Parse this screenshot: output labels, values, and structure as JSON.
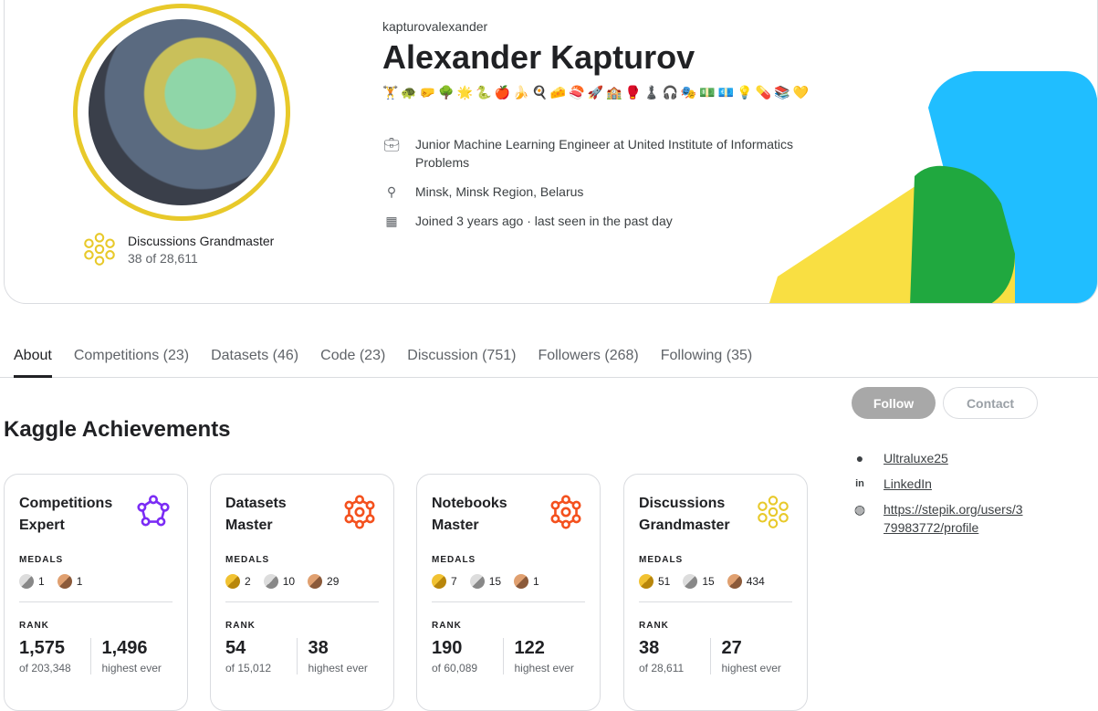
{
  "profile": {
    "username": "kapturovalexander",
    "name": "Alexander Kapturov",
    "emojis": "🏋️🐢🤛🌳🌟🐍🍎🍌🍳🧀🍣🚀🏫🥊♟️🎧🎭💵💶💡💊📚💛",
    "job": "Junior Machine Learning Engineer at United Institute of Informatics Problems",
    "location": "Minsk, Minsk Region, Belarus",
    "joined": "Joined 3 years ago · last seen in the past day",
    "tier": "Discussions Grandmaster",
    "tier_rank": "38 of 28,611"
  },
  "tabs": [
    "About",
    "Competitions (23)",
    "Datasets (46)",
    "Code (23)",
    "Discussion (751)",
    "Followers (268)",
    "Following (35)"
  ],
  "section_title": "Kaggle Achievements",
  "buttons": {
    "follow": "Follow",
    "contact": "Contact"
  },
  "links": [
    {
      "icon": "github-icon",
      "text": "Ultraluxe25"
    },
    {
      "icon": "linkedin-icon",
      "text": "LinkedIn"
    },
    {
      "icon": "globe-icon",
      "text": "https://stepik.org/users/379983772/profile"
    }
  ],
  "labels": {
    "medals": "MEDALS",
    "rank": "RANK",
    "highest": "highest ever"
  },
  "cards": [
    {
      "title": "Competitions Expert",
      "color": "#7b2cf5",
      "medals": {
        "silver": "1",
        "bronze": "1"
      },
      "rank": "1,575",
      "of": "of 203,348",
      "highest": "1,496"
    },
    {
      "title": "Datasets Master",
      "color": "#f4511e",
      "medals": {
        "gold": "2",
        "silver": "10",
        "bronze": "29"
      },
      "rank": "54",
      "of": "of 15,012",
      "highest": "38"
    },
    {
      "title": "Notebooks Master",
      "color": "#f4511e",
      "medals": {
        "gold": "7",
        "silver": "15",
        "bronze": "1"
      },
      "rank": "190",
      "of": "of 60,089",
      "highest": "122"
    },
    {
      "title": "Discussions Grandmaster",
      "color": "#e8c92a",
      "medals": {
        "gold": "51",
        "silver": "15",
        "bronze": "434"
      },
      "rank": "38",
      "of": "of 28,611",
      "highest": "27"
    }
  ]
}
